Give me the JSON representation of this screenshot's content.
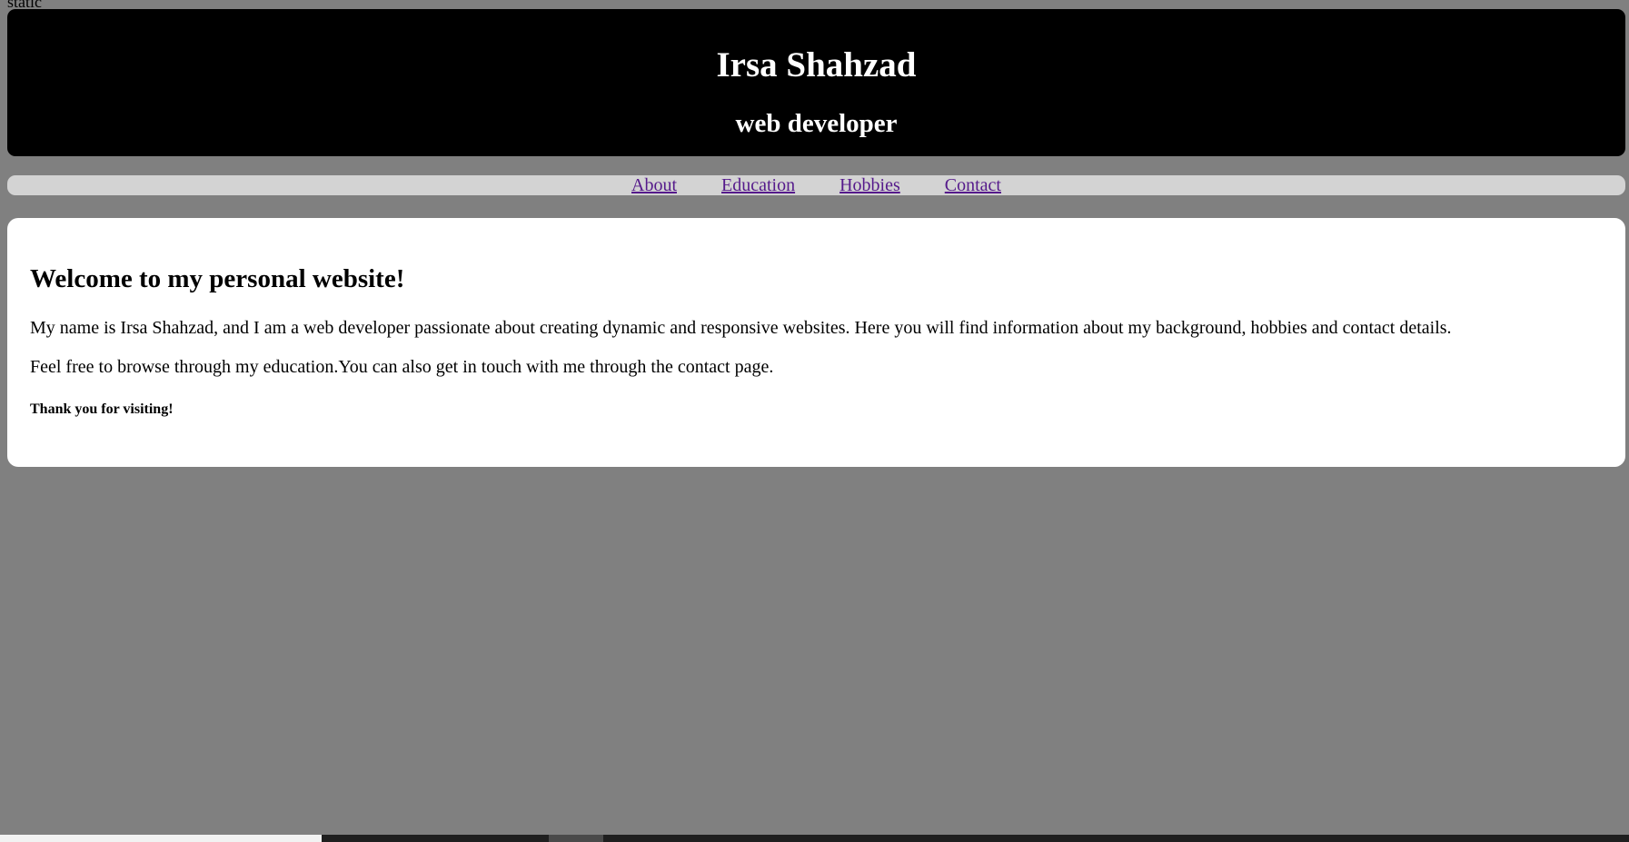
{
  "top_label": "static",
  "header": {
    "name": "Irsa Shahzad",
    "role": "web developer"
  },
  "nav": {
    "items": [
      {
        "label": "About"
      },
      {
        "label": "Education"
      },
      {
        "label": "Hobbies"
      },
      {
        "label": "Contact"
      }
    ]
  },
  "main": {
    "heading": "Welcome to my personal website!",
    "paragraph1": "My name is Irsa Shahzad, and I am a web developer passionate about creating dynamic and responsive websites. Here you will find information about my background, hobbies and contact details.",
    "paragraph2": "Feel free to browse through my education.You can also get in touch with me through the contact page.",
    "thanks": "Thank you for visiting!"
  },
  "colors": {
    "page_background": "#808080",
    "header_background": "#000000",
    "nav_background": "#d3d3d3",
    "link_color": "#551a8b"
  }
}
